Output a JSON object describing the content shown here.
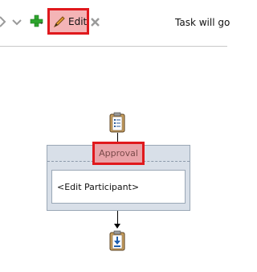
{
  "toolbar": {
    "edit_label": "Edit",
    "task_text": "Task will go"
  },
  "icons": {
    "left_cut_icon": "diamond-icon",
    "chevron": "chevron-down-icon",
    "add": "plus-icon",
    "edit": "pencil-icon",
    "delete": "close-icon",
    "start": "clipboard-checklist-icon",
    "end": "download-task-icon"
  },
  "stage": {
    "name": "Approval",
    "participant": "<Edit Participant>"
  },
  "colors": {
    "highlight_border": "#e0191d",
    "stage_bg": "#d8dfe8",
    "plus_green": "#2ea52e"
  }
}
